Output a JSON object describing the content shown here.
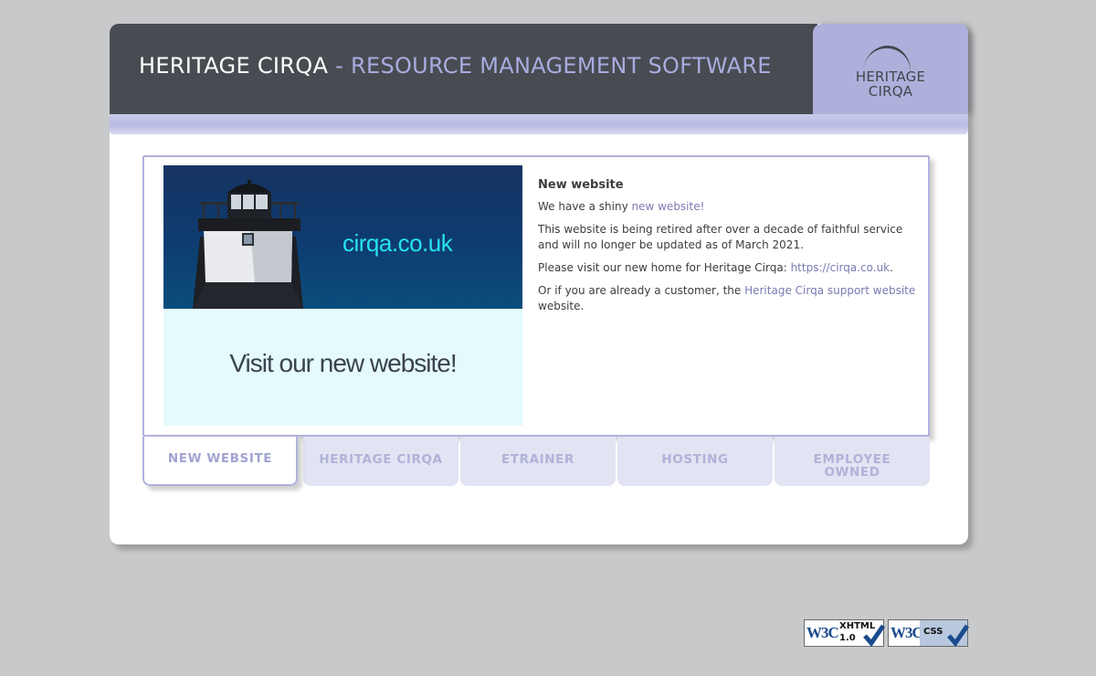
{
  "header": {
    "title_main": "HERITAGE CIRQA",
    "title_sep": " - ",
    "title_sub": "RESOURCE MANAGEMENT SOFTWARE",
    "logo_line1": "HERITAGE",
    "logo_line2": "CIRQA"
  },
  "promo": {
    "url_text": "cirqa.co.uk",
    "visit_text": "Visit our new website!"
  },
  "article": {
    "heading": "New website",
    "p1_text": "We have a shiny ",
    "p1_link": "new website!",
    "p2_text": "This website is being retired after over a decade of faithful service and will no longer be updated as of March 2021.",
    "p3_text": "Please visit our new home for Heritage Cirqa: ",
    "p3_link": "https://cirqa.co.uk",
    "p3_after": ".",
    "p4_text": "Or if you are already a customer, the ",
    "p4_link": "Heritage Cirqa support website",
    "p4_after": " website."
  },
  "tabs": [
    {
      "label": "NEW WEBSITE",
      "active": true
    },
    {
      "label": "HERITAGE CIRQA",
      "active": false
    },
    {
      "label": "ETRAINER",
      "active": false
    },
    {
      "label": "HOSTING",
      "active": false
    },
    {
      "label_line1": "EMPLOYEE",
      "label_line2": "OWNED",
      "active": false
    }
  ],
  "badges": {
    "xhtml_w3c": "W3C",
    "xhtml_kind": "XHTML",
    "xhtml_ver": "1.0",
    "css_w3c": "W3C",
    "css_kind": "CSS"
  },
  "colors": {
    "header_dark": "#484c52",
    "accent_lavender": "#aeb0db",
    "link": "#7a7ab3",
    "promo_cyan": "#27e2f0"
  }
}
